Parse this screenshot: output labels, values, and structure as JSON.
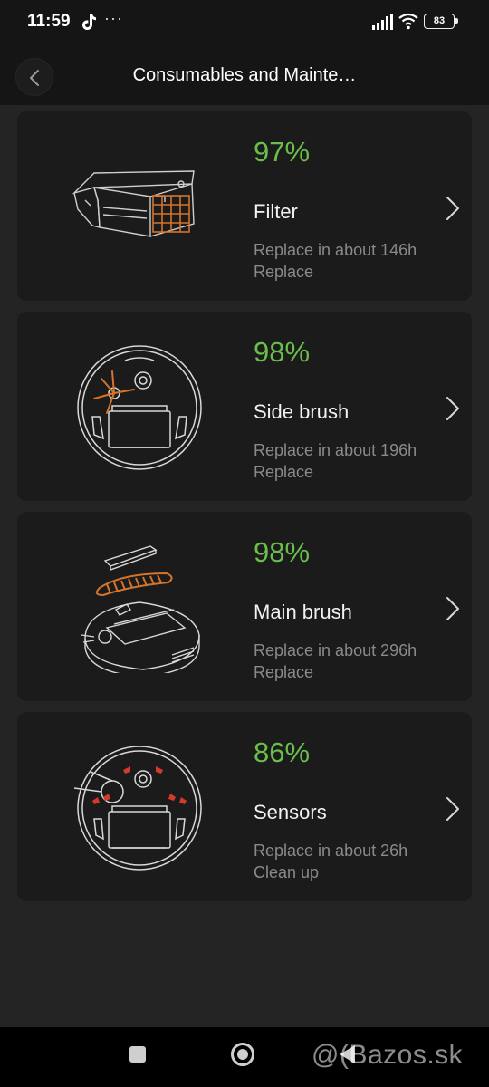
{
  "status_bar": {
    "time": "11:59",
    "notification_dots": "···",
    "battery": "83"
  },
  "header": {
    "title": "Consumables and Mainte…"
  },
  "items": [
    {
      "percent": "97%",
      "name": "Filter",
      "hint": "Replace in about 146h",
      "action": "Replace",
      "icon": "filter-illustration"
    },
    {
      "percent": "98%",
      "name": "Side brush",
      "hint": "Replace in about 196h",
      "action": "Replace",
      "icon": "side-brush-illustration"
    },
    {
      "percent": "98%",
      "name": "Main brush",
      "hint": "Replace in about 296h",
      "action": "Replace",
      "icon": "main-brush-illustration"
    },
    {
      "percent": "86%",
      "name": "Sensors",
      "hint": "Replace in about 26h",
      "action": "Clean up",
      "icon": "sensors-illustration"
    }
  ],
  "watermark": "@(Bazos.sk",
  "colors": {
    "percent_green": "#6abf4b",
    "accent_orange": "#d4742b",
    "sensor_red": "#d43a2a"
  }
}
